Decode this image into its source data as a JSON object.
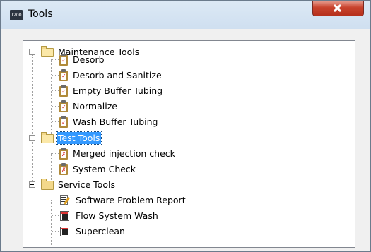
{
  "window": {
    "title": "Tools",
    "app_icon_text": "T200"
  },
  "tree": {
    "groups": [
      {
        "label": "Maintenance Tools",
        "expanded": true,
        "selected": false,
        "items": [
          {
            "label": "Desorb",
            "icon": "clipboard-check-icon"
          },
          {
            "label": "Desorb and Sanitize",
            "icon": "clipboard-check-icon"
          },
          {
            "label": "Empty Buffer Tubing",
            "icon": "clipboard-check-icon"
          },
          {
            "label": "Normalize",
            "icon": "clipboard-check-icon"
          },
          {
            "label": "Wash Buffer Tubing",
            "icon": "clipboard-check-icon"
          }
        ]
      },
      {
        "label": "Test Tools",
        "expanded": true,
        "selected": true,
        "items": [
          {
            "label": "Merged injection check",
            "icon": "test-clipboard-icon"
          },
          {
            "label": "System Check",
            "icon": "test-clipboard-icon"
          }
        ]
      },
      {
        "label": "Service Tools",
        "expanded": true,
        "selected": false,
        "items": [
          {
            "label": "Software Problem Report",
            "icon": "report-document-icon"
          },
          {
            "label": "Flow System Wash",
            "icon": "service-tool-icon"
          },
          {
            "label": "Superclean",
            "icon": "service-tool-icon"
          }
        ]
      }
    ]
  },
  "colors": {
    "selection": "#3399ff",
    "close_button": "#c9442e",
    "titlebar": "#dce9f5"
  }
}
